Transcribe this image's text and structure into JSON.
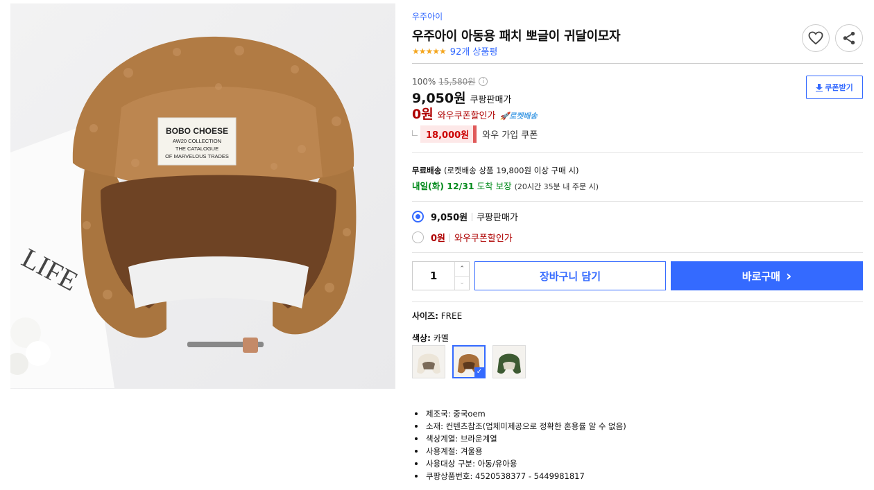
{
  "product": {
    "brand": "우주아이",
    "title": "우주아이 아동용 패치 뽀글이 귀달이모자",
    "stars": "★★★★★",
    "review_count": "92개 상품평",
    "image_patch_lines": [
      "BOBO CHOESE",
      "AW20 COLLECTION",
      "THE CATALOGUE",
      "OF MARVELOUS TRADES"
    ],
    "image_bg_text": "LIFE"
  },
  "actions": {
    "heart_icon": "heart-icon",
    "share_icon": "share-icon"
  },
  "price": {
    "discount": "100%",
    "original": "15,580원",
    "info_icon": "i",
    "main": "9,050원",
    "main_label": "쿠팡판매가",
    "wow": "0원",
    "wow_label": "와우쿠폰할인가",
    "rocket": "로켓배송",
    "coupon_amount": "18,000원",
    "coupon_text": "와우 가입 쿠폰",
    "coupon_button": "쿠폰받기"
  },
  "shipping": {
    "free": "무료배송",
    "free_desc": "(로켓배송 상품 19,800원 이상 구매 시)",
    "arrival": "내일(화) 12/31",
    "arrival_suffix": "도착 보장",
    "arrival_note": "(20시간 35분 내 주문 시)"
  },
  "options": [
    {
      "price": "9,050원",
      "label": "쿠팡판매가",
      "selected": true
    },
    {
      "price": "0원",
      "label": "와우쿠폰할인가",
      "selected": false
    }
  ],
  "purchase": {
    "quantity": "1",
    "up": "⌃",
    "down": "⌄",
    "cart": "장바구니 담기",
    "buy": "바로구매",
    "buy_arrow": "›"
  },
  "variants": {
    "size_key": "사이즈:",
    "size_value": "FREE",
    "color_key": "색상:",
    "color_value": "카멜",
    "swatches": [
      {
        "name": "ivory",
        "color": "#ece5d8"
      },
      {
        "name": "camel",
        "color": "#a86f3a"
      },
      {
        "name": "khaki",
        "color": "#3d5a32"
      }
    ],
    "check": "✓"
  },
  "specs": [
    "제조국: 중국oem",
    "소재: 컨텐츠참조(업체미제공으로 정확한 혼용률 알 수 없음)",
    "색상계열: 브라운계열",
    "사용계절: 겨울용",
    "사용대상 구분: 아동/유아용",
    "쿠팡상품번호: 4520538377 - 5449981817"
  ],
  "colors": {
    "accent": "#346aff",
    "wow_red": "#ae0000",
    "green": "#00891a",
    "star": "#f4a51c"
  }
}
